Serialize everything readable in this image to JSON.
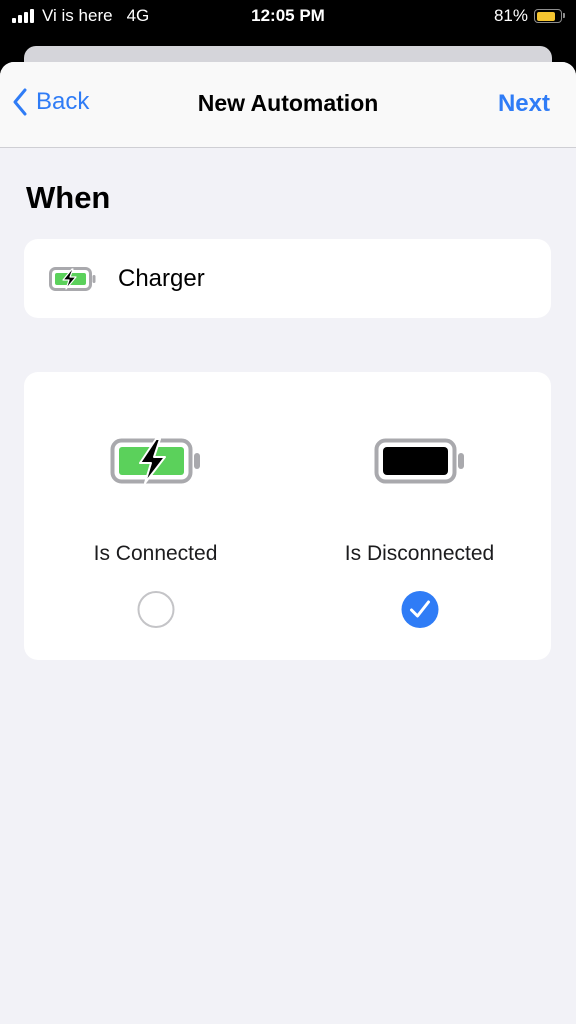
{
  "status_bar": {
    "carrier": "Vi is here",
    "network": "4G",
    "time": "12:05 PM",
    "battery_percent": "81%",
    "battery_level": 0.81,
    "battery_color": "#f4c430"
  },
  "nav": {
    "back_label": "Back",
    "title": "New Automation",
    "next_label": "Next",
    "accent_color": "#2f7cf6"
  },
  "section": {
    "title": "When"
  },
  "trigger": {
    "label": "Charger",
    "icon": "charging-battery-icon"
  },
  "options": [
    {
      "label": "Is Connected",
      "icon": "charging-battery-icon",
      "selected": false
    },
    {
      "label": "Is Disconnected",
      "icon": "battery-full-icon",
      "selected": true
    }
  ]
}
